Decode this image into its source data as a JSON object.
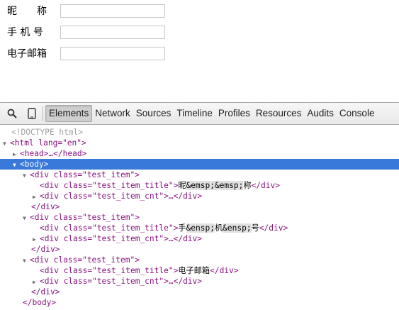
{
  "form": {
    "rows": [
      {
        "label": "昵　　称"
      },
      {
        "label": "手 机 号"
      },
      {
        "label": "电子邮箱"
      }
    ]
  },
  "toolbar": {
    "tabs": [
      "Elements",
      "Network",
      "Sources",
      "Timeline",
      "Profiles",
      "Resources",
      "Audits",
      "Console"
    ],
    "active": "Elements"
  },
  "tree": {
    "doctype": "<!DOCTYPE html>",
    "html_open": "<html lang=\"en\">",
    "head": "<head>…</head>",
    "body_open": "<body>",
    "body_close": "</body>",
    "div_open": "<div class=\"test_item\">",
    "div_close": "</div>",
    "items": [
      {
        "title_pre": "<div class=\"test_item_title\">",
        "title_text": [
          "昵",
          "&emsp;&emsp;",
          "称"
        ],
        "title_post": "</div>",
        "cnt": "<div class=\"test_item_cnt\">…</div>"
      },
      {
        "title_pre": "<div class=\"test_item_title\">",
        "title_text": [
          "手",
          "&ensp;",
          "机",
          "&ensp;",
          "号"
        ],
        "title_post": "</div>",
        "cnt": "<div class=\"test_item_cnt\">…</div>"
      },
      {
        "title_pre": "<div class=\"test_item_title\">",
        "title_text": [
          "电子邮箱"
        ],
        "title_post": "</div>",
        "cnt": "<div class=\"test_item_cnt\">…</div>"
      }
    ]
  }
}
